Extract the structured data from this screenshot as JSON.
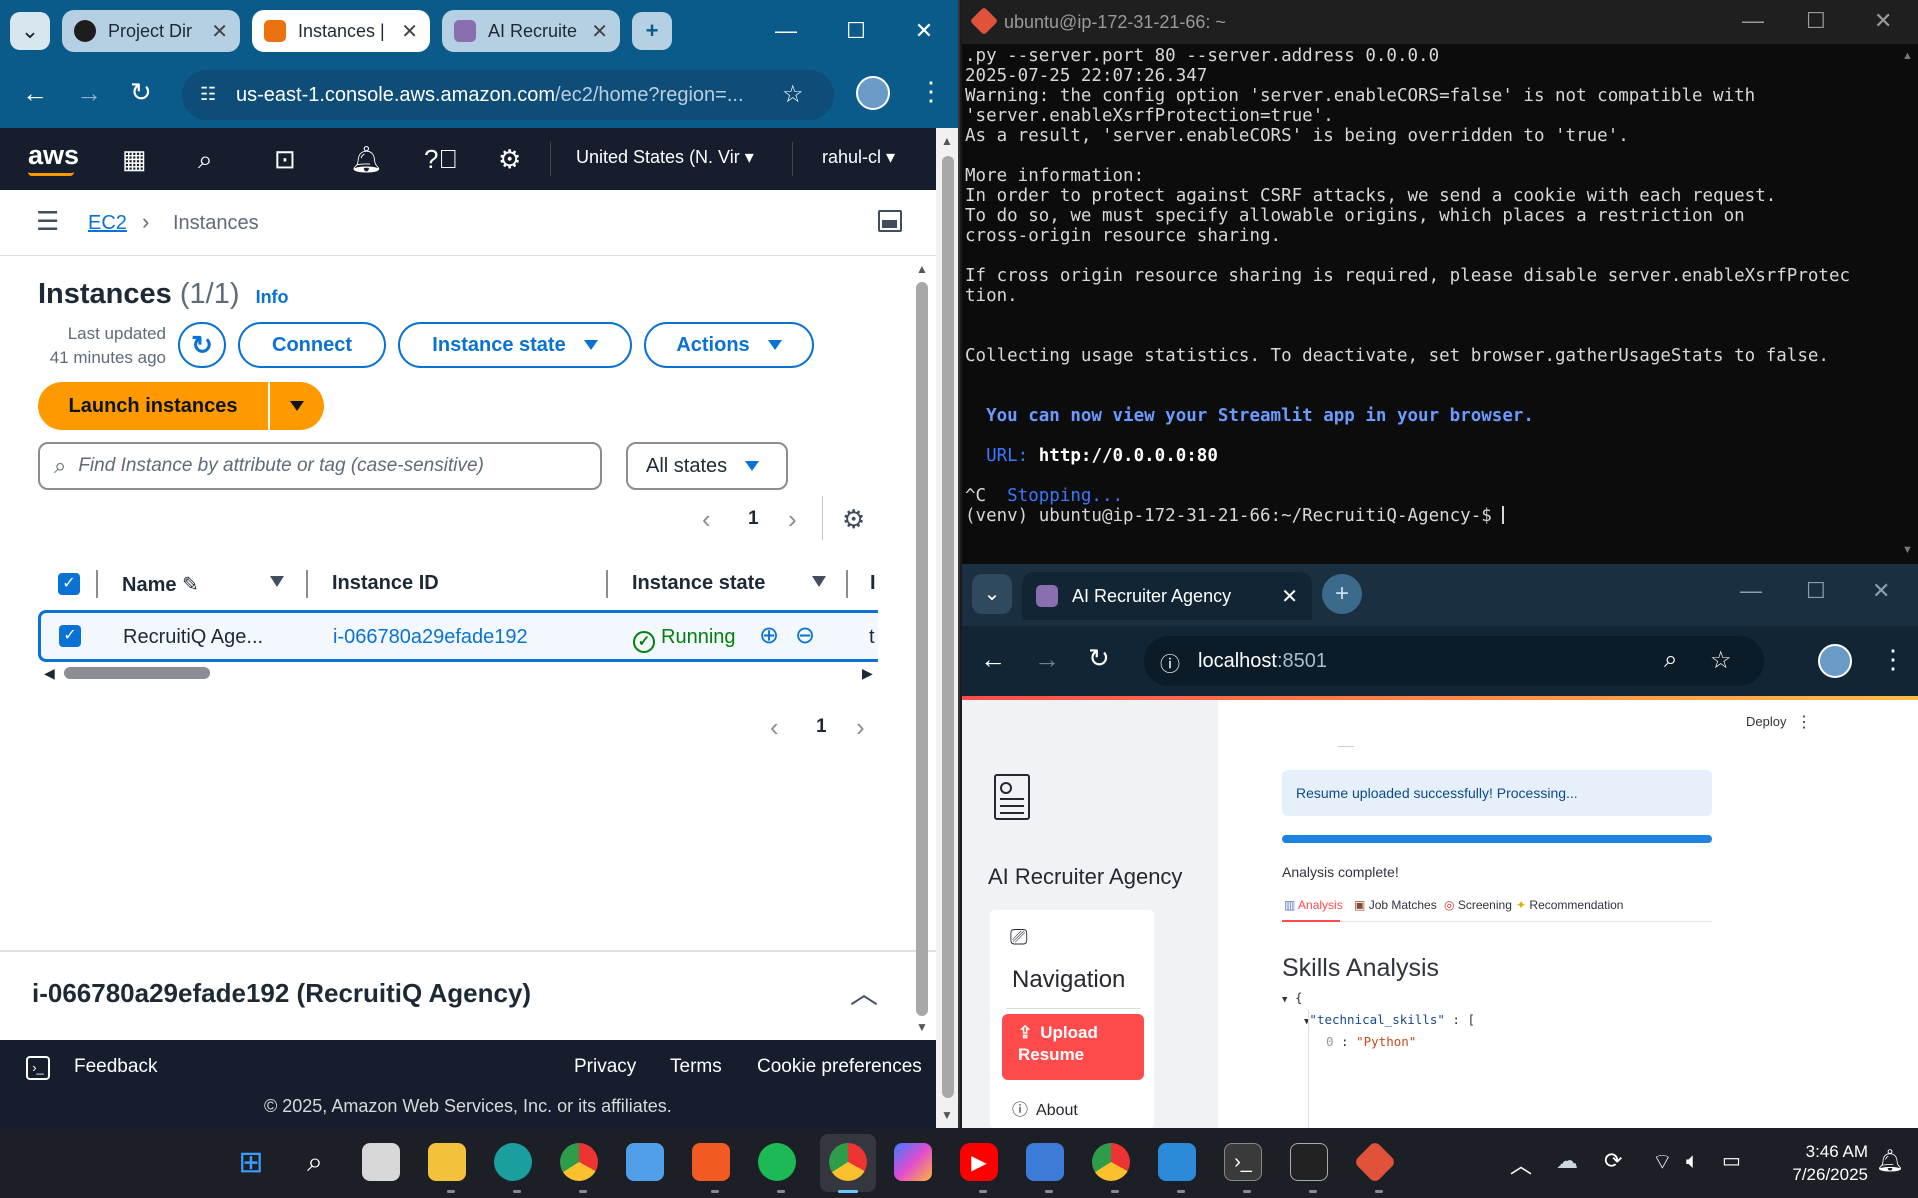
{
  "left_browser": {
    "tabs": [
      {
        "label": "Project Dir"
      },
      {
        "label": "Instances |"
      },
      {
        "label": "AI Recruite"
      }
    ],
    "url_host": "us-east-1.console.aws.amazon.com",
    "url_path": "/ec2/home?region=..."
  },
  "aws_bar": {
    "logo": "aws",
    "region": "United States (N. Vir",
    "account": "rahul-cl"
  },
  "breadcrumb": {
    "ec2": "EC2",
    "current": "Instances"
  },
  "instances": {
    "title": "Instances",
    "count": "(1/1)",
    "info": "Info",
    "last_updated_line1": "Last updated",
    "last_updated_line2": "41 minutes ago",
    "connect": "Connect",
    "instance_state": "Instance state",
    "actions": "Actions",
    "launch": "Launch instances",
    "search_placeholder": "Find Instance by attribute or tag (case-sensitive)",
    "filter": "All states",
    "page": "1",
    "columns": {
      "name": "Name",
      "id": "Instance ID",
      "state": "Instance state",
      "next": "I"
    },
    "rows": [
      {
        "name": "RecruitiQ Age...",
        "id": "i-066780a29efade192",
        "state": "Running",
        "extra": "t"
      }
    ],
    "page_bottom": "1"
  },
  "detail_panel": {
    "title": "i-066780a29efade192 (RecruitiQ Agency)"
  },
  "footer": {
    "feedback": "Feedback",
    "privacy": "Privacy",
    "terms": "Terms",
    "cookies": "Cookie preferences",
    "copyright": "© 2025, Amazon Web Services, Inc. or its affiliates."
  },
  "terminal": {
    "title": "ubuntu@ip-172-31-21-66: ~",
    "lines": [
      ".py --server.port 80 --server.address 0.0.0.0",
      "2025-07-25 22:07:26.347",
      "Warning: the config option 'server.enableCORS=false' is not compatible with",
      "'server.enableXsrfProtection=true'.",
      "As a result, 'server.enableCORS' is being overridden to 'true'.",
      "",
      "More information:",
      "In order to protect against CSRF attacks, we send a cookie with each request.",
      "To do so, we must specify allowable origins, which places a restriction on",
      "cross-origin resource sharing.",
      "",
      "If cross origin resource sharing is required, please disable server.enableXsrfProtec",
      "tion.",
      "",
      "",
      "Collecting usage statistics. To deactivate, set browser.gatherUsageStats to false.",
      "",
      ""
    ],
    "streamlit_msg": "  You can now view your Streamlit app in your browser.",
    "url_label": "  URL: ",
    "url_value": "http://0.0.0.0:80",
    "ctrl_c": "^C",
    "stopping": "  Stopping...",
    "prompt": "(venv) ubuntu@ip-172-31-21-66:~/RecruitiQ-Agency-$ "
  },
  "right_browser": {
    "tab_label": "AI Recruiter Agency",
    "url_host": "localhost",
    "url_port": ":8501",
    "deploy": "Deploy",
    "app_title": "AI Recruiter Agency",
    "nav_heading": "Navigation",
    "upload_line1": "Upload",
    "upload_line2": "Resume",
    "about": "About",
    "info_msg": "Resume uploaded successfully! Processing...",
    "progress": 1.0,
    "analysis_complete": "Analysis complete!",
    "tabs": [
      "Analysis",
      "Job Matches",
      "Screening",
      "Recommendation"
    ],
    "skills_heading": "Skills Analysis",
    "json_brace": "{",
    "json_key": "\"technical_skills\"",
    "json_colon": " : [",
    "json_idx": "0",
    "json_val": "\"Python\""
  },
  "taskbar": {
    "time": "3:46 AM",
    "date": "7/26/2025"
  },
  "colors": {
    "aws_orange": "#ff9900",
    "aws_blue": "#0972d3",
    "running_green": "#037f0c",
    "upload_red": "#ff4b4b"
  }
}
